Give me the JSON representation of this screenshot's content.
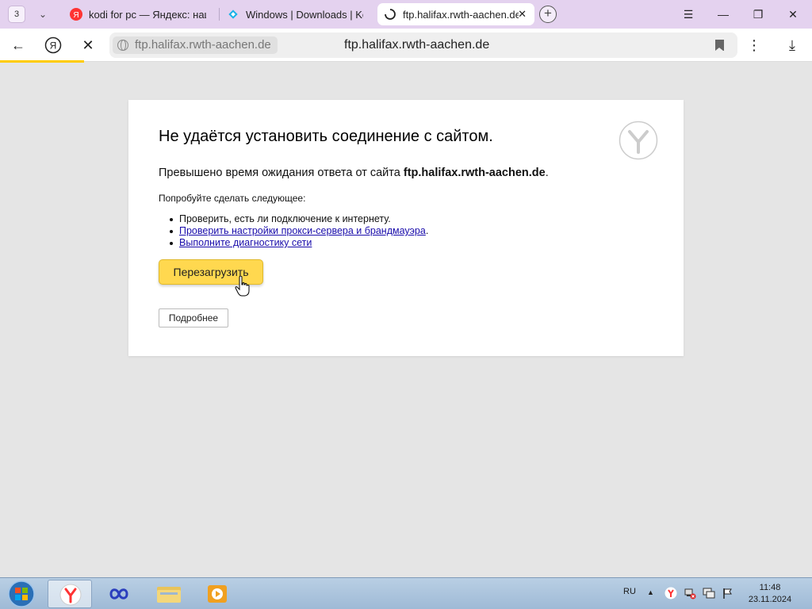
{
  "browser": {
    "tab_count": "3",
    "tabs": [
      {
        "label": "kodi for pc — Яндекс: нашлось"
      },
      {
        "label": "Windows | Downloads | Kodi"
      },
      {
        "label": "ftp.halifax.rwth-aachen.de"
      }
    ],
    "address_host": "ftp.halifax.rwth-aachen.de",
    "address_center": "ftp.halifax.rwth-aachen.de"
  },
  "error": {
    "title": "Не удаётся установить соединение с сайтом.",
    "subtitle_prefix": "Превышено время ожидания ответа от сайта ",
    "subtitle_host": "ftp.halifax.rwth-aachen.de",
    "subtitle_suffix": ".",
    "try_label": "Попробуйте сделать следующее:",
    "suggestions": [
      {
        "text": "Проверить, есть ли подключение к интернету."
      },
      {
        "link": "Проверить настройки прокси-сервера и брандмауэра",
        "suffix": "."
      },
      {
        "link": "Выполните диагностику сети"
      }
    ],
    "reload_label": "Перезагрузить",
    "details_label": "Подробнее"
  },
  "taskbar": {
    "language": "RU",
    "time": "11:48",
    "date": "23.11.2024"
  },
  "colors": {
    "tab_strip": "#e4d2ef",
    "accent_yellow": "#ffd84f",
    "link": "#1a0dab"
  }
}
